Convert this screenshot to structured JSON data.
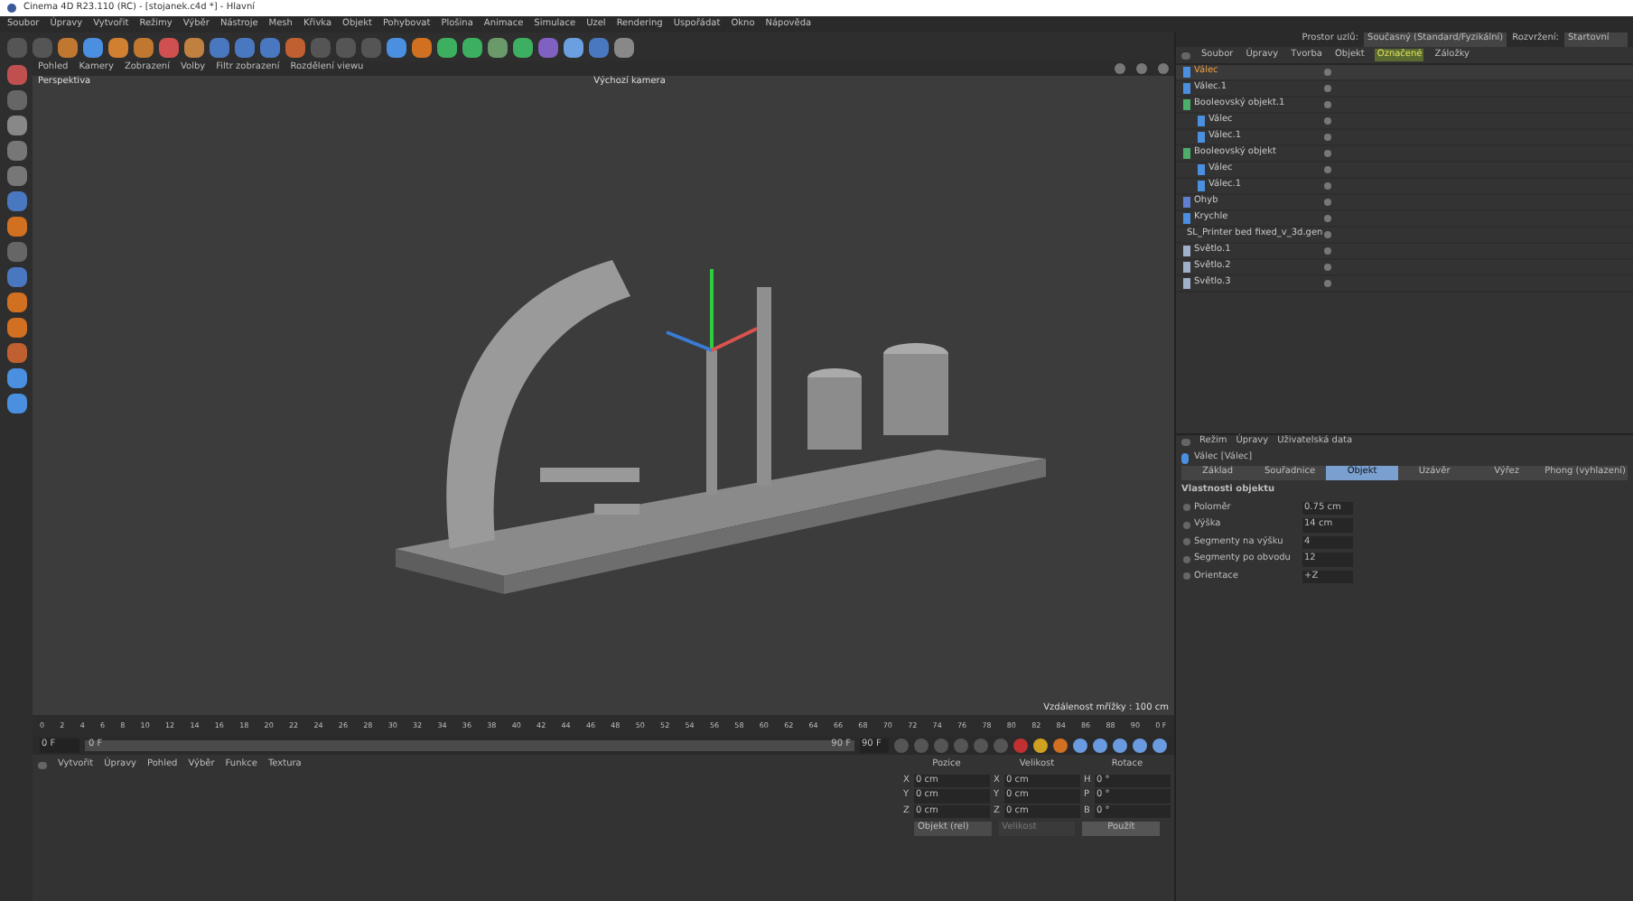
{
  "window": {
    "title": "Cinema 4D R23.110 (RC) - [stojanek.c4d *] - Hlavní"
  },
  "menu": [
    "Soubor",
    "Úpravy",
    "Vytvořit",
    "Režimy",
    "Výběr",
    "Nástroje",
    "Mesh",
    "Křivka",
    "Objekt",
    "Pohybovat",
    "Plošina",
    "Animace",
    "Simulace",
    "Uzel",
    "Rendering",
    "Uspořádat",
    "Okno",
    "Nápověda"
  ],
  "layout": {
    "node_space_label": "Prostor uzlů:",
    "node_space": "Současný (Standard/Fyzikální)",
    "layout_label": "Rozvržení:",
    "layout": "Startovní"
  },
  "viewport": {
    "menu": [
      "Pohled",
      "Kamery",
      "Zobrazení",
      "Volby",
      "Filtr zobrazení",
      "Rozdělení viewu"
    ],
    "name": "Perspektiva",
    "camera": "Výchozí kamera",
    "grid": "Vzdálenost mřížky : 100 cm"
  },
  "objects_panel": {
    "menu": [
      {
        "label": "Soubor",
        "selected": false
      },
      {
        "label": "Úpravy",
        "selected": false
      },
      {
        "label": "Tvorba",
        "selected": false
      },
      {
        "label": "Objekt",
        "selected": false
      },
      {
        "label": "Označené",
        "selected": true
      },
      {
        "label": "Záložky",
        "selected": false
      }
    ],
    "items": [
      {
        "name": "Válec",
        "kind": "cylinder",
        "selected": true
      },
      {
        "name": "Válec.1",
        "kind": "cylinder",
        "selected": false
      },
      {
        "name": "Booleovský objekt.1",
        "kind": "boole",
        "selected": false,
        "children": [
          {
            "name": "Válec",
            "kind": "cylinder",
            "selected": false
          },
          {
            "name": "Válec.1",
            "kind": "cylinder",
            "selected": false
          }
        ]
      },
      {
        "name": "Booleovský objekt",
        "kind": "boole",
        "selected": false,
        "children": [
          {
            "name": "Válec",
            "kind": "cylinder",
            "selected": false
          },
          {
            "name": "Válec.1",
            "kind": "cylinder",
            "selected": false
          }
        ]
      },
      {
        "name": "Ohyb",
        "kind": "deformer",
        "selected": false
      },
      {
        "name": "Krychle",
        "kind": "cylinder",
        "selected": false
      },
      {
        "name": "SL_Printer bed fixed_v_3d.gen",
        "kind": "mesh",
        "selected": false
      },
      {
        "name": "Světlo.1",
        "kind": "light",
        "selected": false
      },
      {
        "name": "Světlo.2",
        "kind": "light",
        "selected": false
      },
      {
        "name": "Světlo.3",
        "kind": "light",
        "selected": false
      }
    ]
  },
  "attributes": {
    "menu": [
      "Režim",
      "Úpravy",
      "Uživatelská data"
    ],
    "object": "Válec [Válec]",
    "tabs": [
      {
        "label": "Základ",
        "selected": false
      },
      {
        "label": "Souřadnice",
        "selected": false
      },
      {
        "label": "Objekt",
        "selected": true
      },
      {
        "label": "Uzávěr",
        "selected": false
      },
      {
        "label": "Výřez",
        "selected": false
      },
      {
        "label": "Phong (vyhlazení)",
        "selected": false
      }
    ],
    "section": "Vlastnosti objektu",
    "fields": [
      {
        "label": "Poloměr",
        "value": "0.75 cm"
      },
      {
        "label": "Výška",
        "value": "14 cm"
      },
      {
        "label": "Segmenty na výšku",
        "value": "4"
      },
      {
        "label": "Segmenty po obvodu",
        "value": "12"
      },
      {
        "label": "Orientace",
        "value": "+Z"
      }
    ]
  },
  "timeline": {
    "ticks": [
      "0",
      "2",
      "4",
      "6",
      "8",
      "10",
      "12",
      "14",
      "16",
      "18",
      "20",
      "22",
      "24",
      "26",
      "28",
      "30",
      "32",
      "34",
      "36",
      "38",
      "40",
      "42",
      "44",
      "46",
      "48",
      "50",
      "52",
      "54",
      "56",
      "58",
      "60",
      "62",
      "64",
      "66",
      "68",
      "70",
      "72",
      "74",
      "76",
      "78",
      "80",
      "82",
      "84",
      "86",
      "88",
      "90"
    ],
    "end_label": "0 F",
    "start": "0 F",
    "start2": "0 F",
    "end": "90 F",
    "end2": "90 F"
  },
  "materials": {
    "menu": [
      "Vytvořit",
      "Úpravy",
      "Pohled",
      "Výběr",
      "Funkce",
      "Textura"
    ]
  },
  "coordinates": {
    "headers": [
      "Pozice",
      "Velikost",
      "Rotace"
    ],
    "rows": [
      [
        "X",
        "0 cm",
        "X",
        "0 cm",
        "H",
        "0 °"
      ],
      [
        "Y",
        "0 cm",
        "Y",
        "0 cm",
        "P",
        "0 °"
      ],
      [
        "Z",
        "0 cm",
        "Z",
        "0 cm",
        "B",
        "0 °"
      ]
    ],
    "mode": "Objekt (rel)",
    "size_mode": "Velikost",
    "apply": "Použít"
  }
}
